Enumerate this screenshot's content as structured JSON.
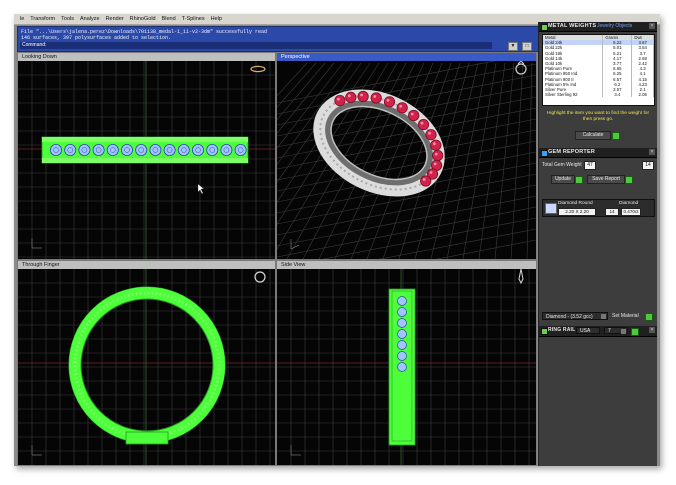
{
  "menu": [
    "le",
    "Transform",
    "Tools",
    "Analyze",
    "Render",
    "RhinoGold",
    "Blend",
    "T-Splines",
    "Help"
  ],
  "command": {
    "line1": "File \"...\\Users\\jalena.perez\\Downloads\\701138_medal-1_11-v2-3dm\" successfully read",
    "line2": "146 surfaces, 397 polysurfaces added to selection.",
    "prompt": "Command:",
    "btn1": "▼",
    "btn2": "□"
  },
  "viewports": {
    "top": "Looking Down",
    "perspective": "Perspective",
    "front": "Through Finger",
    "right": "Side View"
  },
  "metal_weights": {
    "title": "METAL WEIGHTS",
    "subtitle": "Jewelry Objects",
    "columns": [
      "Metal",
      "Grams",
      "Dwt"
    ],
    "rows": [
      [
        "Gold 24k",
        "6.22",
        "3.67"
      ],
      [
        "Gold 22k",
        "5.01",
        "3.54"
      ],
      [
        "Gold 18k",
        "5.21",
        "3.7"
      ],
      [
        "Gold 14k",
        "4.17",
        "2.68"
      ],
      [
        "Gold 10k",
        "3.77",
        "2.42"
      ],
      [
        "Platinum Pure",
        "6.65",
        "4.3"
      ],
      [
        "Platinum 950 Ind",
        "6.25",
        "4.1"
      ],
      [
        "Platinum 900 Ir",
        "6.57",
        "4.15"
      ],
      [
        "Platinum 5% Ind",
        "6.2",
        "4.23"
      ],
      [
        "Silver Pure",
        "3.57",
        "2.1"
      ],
      [
        "Silver Sterling 92",
        "3.4",
        "2.05"
      ]
    ],
    "highlighted_row": 0,
    "note": "Highlight the item you want to find the weight for then press go.",
    "calculate_label": "Calculate"
  },
  "gem_reporter": {
    "title": "GEM REPORTER",
    "total_weight_label": "Total Gem Weight",
    "total_weight_value": "47",
    "total_count_label": "Total Gem Count",
    "total_count_value": "14",
    "update_label": "Update",
    "save_label": "Save Report",
    "gem_name": "Diamond Round",
    "gem_size": "2.20 X 2.20",
    "gem_type": "Diamond",
    "gem_count": "14",
    "gem_weight": "0.470ct"
  },
  "material": {
    "select_value": "Diamond - (3.52 gcc)",
    "set_label": "Set Material"
  },
  "ring_rail": {
    "label": "RING RAIL",
    "region": "USA",
    "size": "7"
  },
  "colors": {
    "wire_green": "#4cff3a",
    "grid": "#3c3c3c",
    "ruby": "#d1224a",
    "panel": "#3d3d3d",
    "command_blue": "#2b49a8"
  }
}
